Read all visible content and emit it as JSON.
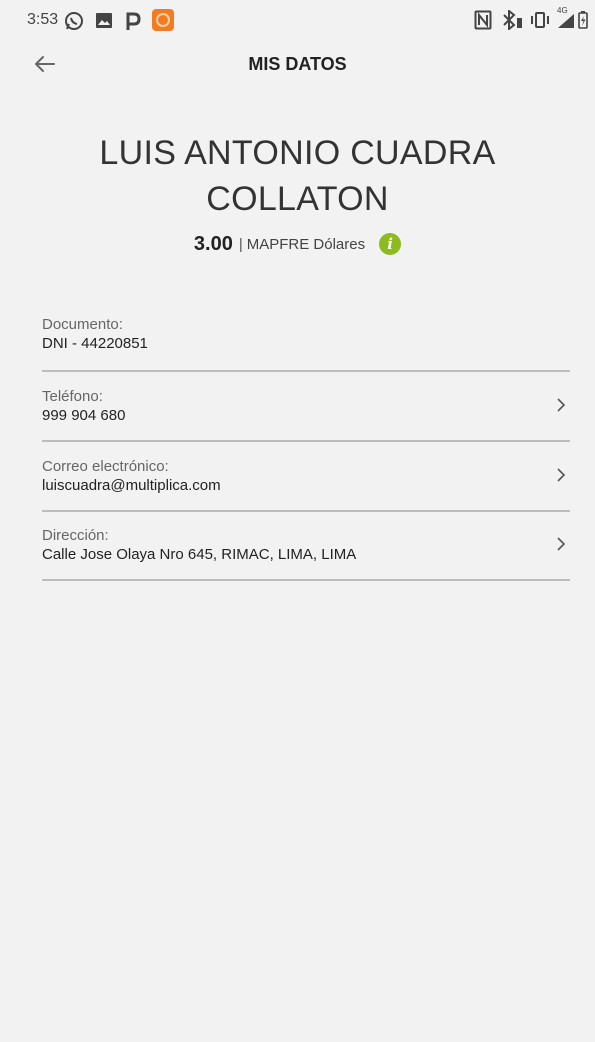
{
  "status_bar": {
    "time": "3:53",
    "left_icons": [
      "whatsapp-icon",
      "image-icon",
      "p-icon",
      "app-notification-icon"
    ],
    "right_icons": [
      "nfc-icon",
      "bluetooth-icon",
      "vibrate-icon",
      "signal-icon",
      "battery-icon"
    ],
    "network_label": "4G"
  },
  "header": {
    "title": "MIS DATOS",
    "back_icon": "arrow-left-icon"
  },
  "profile": {
    "name_line1": "LUIS ANTONIO CUADRA",
    "name_line2": "COLLATON",
    "points": "3.00",
    "separator": "|",
    "points_unit": "MAPFRE Dólares",
    "info_symbol": "i"
  },
  "fields": [
    {
      "label": "Documento:",
      "value": "DNI - 44220851",
      "has_chevron": false
    },
    {
      "label": "Teléfono:",
      "value": "999 904 680",
      "has_chevron": true
    },
    {
      "label": "Correo electrónico:",
      "value": "luiscuadra@multiplica.com",
      "has_chevron": true
    },
    {
      "label": "Dirección:",
      "value": "Calle Jose Olaya Nro 645, RIMAC, LIMA, LIMA",
      "has_chevron": true
    }
  ],
  "colors": {
    "background": "#f2f2f2",
    "info_accent": "#8cba1f",
    "divider": "#bdbdbd",
    "app_notification": "#f47c20"
  }
}
